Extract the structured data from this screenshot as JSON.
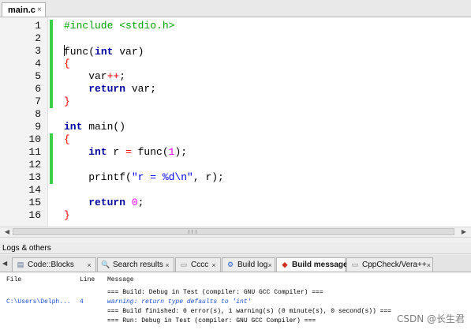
{
  "editor": {
    "tab_label": "main.c",
    "tab_close": "×",
    "lines": [
      {
        "n": "1",
        "changed": true,
        "tokens": [
          [
            "pre",
            "#include <stdio.h>"
          ]
        ]
      },
      {
        "n": "2",
        "changed": true,
        "tokens": []
      },
      {
        "n": "3",
        "changed": true,
        "cursor": true,
        "tokens": [
          [
            "txt",
            "func("
          ],
          [
            "kw",
            "int"
          ],
          [
            "txt",
            " var)"
          ]
        ]
      },
      {
        "n": "4",
        "changed": true,
        "tokens": [
          [
            "br",
            "{"
          ]
        ]
      },
      {
        "n": "5",
        "changed": true,
        "tokens": [
          [
            "txt",
            "    var"
          ],
          [
            "op",
            "++"
          ],
          [
            "txt",
            ";"
          ]
        ]
      },
      {
        "n": "6",
        "changed": true,
        "tokens": [
          [
            "kw",
            "    return"
          ],
          [
            "txt",
            " var;"
          ]
        ]
      },
      {
        "n": "7",
        "changed": true,
        "tokens": [
          [
            "br",
            "}"
          ]
        ]
      },
      {
        "n": "8",
        "changed": false,
        "tokens": []
      },
      {
        "n": "9",
        "changed": false,
        "tokens": [
          [
            "kw",
            "int"
          ],
          [
            "txt",
            " main()"
          ]
        ]
      },
      {
        "n": "10",
        "changed": true,
        "tokens": [
          [
            "br",
            "{"
          ]
        ]
      },
      {
        "n": "11",
        "changed": true,
        "tokens": [
          [
            "kw",
            "    int"
          ],
          [
            "txt",
            " r "
          ],
          [
            "op",
            "="
          ],
          [
            "txt",
            " func("
          ],
          [
            "num",
            "1"
          ],
          [
            "txt",
            ");"
          ]
        ]
      },
      {
        "n": "12",
        "changed": true,
        "tokens": []
      },
      {
        "n": "13",
        "changed": true,
        "tokens": [
          [
            "txt",
            "    printf("
          ],
          [
            "str",
            "\"r = %d\\n\""
          ],
          [
            "txt",
            ", r);"
          ]
        ]
      },
      {
        "n": "14",
        "changed": false,
        "tokens": []
      },
      {
        "n": "15",
        "changed": false,
        "tokens": [
          [
            "kw",
            "    return"
          ],
          [
            "txt",
            " "
          ],
          [
            "num",
            "0"
          ],
          [
            "txt",
            ";"
          ]
        ]
      },
      {
        "n": "16",
        "changed": false,
        "tokens": [
          [
            "br",
            "}"
          ]
        ]
      }
    ]
  },
  "logs_panel": {
    "title": "Logs & others",
    "tabs": [
      {
        "label": "Code::Blocks",
        "icon": "code-blocks-icon",
        "glyph": "▤",
        "color": "#5a6b8c",
        "active": false
      },
      {
        "label": "Search results",
        "icon": "search-icon",
        "glyph": "🔍",
        "color": "#3a6fb0",
        "active": false
      },
      {
        "label": "Cccc",
        "icon": "document-icon",
        "glyph": "▭",
        "color": "#7a7a7a",
        "active": false
      },
      {
        "label": "Build log",
        "icon": "build-gear-icon",
        "glyph": "⚙",
        "color": "#2a62c8",
        "active": false
      },
      {
        "label": "Build messages",
        "icon": "build-messages-icon",
        "glyph": "◆",
        "color": "#d03020",
        "active": true
      },
      {
        "label": "CppCheck/Vera++",
        "icon": "cppcheck-icon",
        "glyph": "▭",
        "color": "#7a7a7a",
        "active": false
      }
    ],
    "tab_close": "×",
    "table": {
      "columns": {
        "file": "File",
        "line": "Line",
        "message": "Message"
      },
      "rows": [
        {
          "file": "",
          "line": "",
          "message": "=== Build: Debug in Test (compiler: GNU GCC Compiler) ===",
          "kind": "normal"
        },
        {
          "file": "C:\\Users\\Delph...",
          "line": "4",
          "message": "warning: return type defaults to 'int'",
          "kind": "warning"
        },
        {
          "file": "",
          "line": "",
          "message": "=== Build finished: 0 error(s), 1 warning(s) (0 minute(s), 0 second(s)) ===",
          "kind": "normal"
        },
        {
          "file": "",
          "line": "",
          "message": "=== Run: Debug in Test (compiler: GNU GCC Compiler) ===",
          "kind": "normal"
        }
      ]
    }
  },
  "watermark": "CSDN @长生君",
  "colors": {
    "keyword": "#0000a0",
    "preprocessor": "#00a000",
    "operator": "#ff0000",
    "number": "#f000f0",
    "string": "#0000ff",
    "change_bar": "#3bd04b",
    "warning_text": "#1a4fd0"
  }
}
